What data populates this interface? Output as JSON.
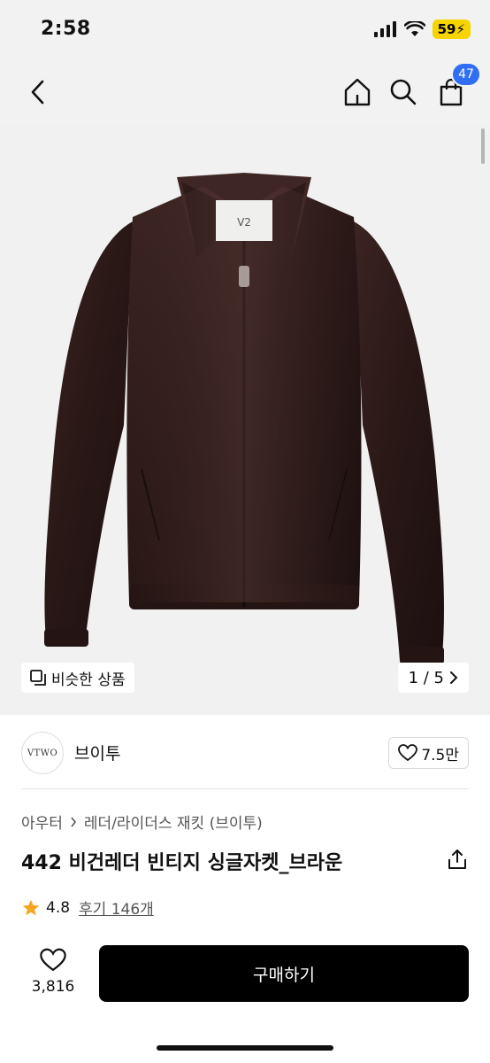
{
  "status": {
    "time": "2:58",
    "battery": "59"
  },
  "nav": {
    "back_icon": "chevron-left-icon",
    "home_icon": "home-icon",
    "search_icon": "search-icon",
    "cart_icon": "cart-icon",
    "cart_count": "47"
  },
  "hero": {
    "image": "brown-leather-jacket-photo",
    "tag_label": "V2",
    "similar_label": "비슷한 상품",
    "page": "1 / 5"
  },
  "brand": {
    "logo_text": "VTWO",
    "name": "브이투",
    "likes": "7.5만"
  },
  "breadcrumb": {
    "level1": "아우터",
    "level2": "레더/라이더스 재킷 (브이투)"
  },
  "product": {
    "title": "442 비건레더 빈티지 싱글자켓_브라운"
  },
  "rating": {
    "score": "4.8",
    "reviews": "후기 146개"
  },
  "bottom": {
    "like_count": "3,816",
    "buy_label": "구매하기"
  },
  "colors": {
    "accent_badge": "#2f6ef5",
    "rating_star": "#f5a623",
    "buy_button": "#000000"
  }
}
